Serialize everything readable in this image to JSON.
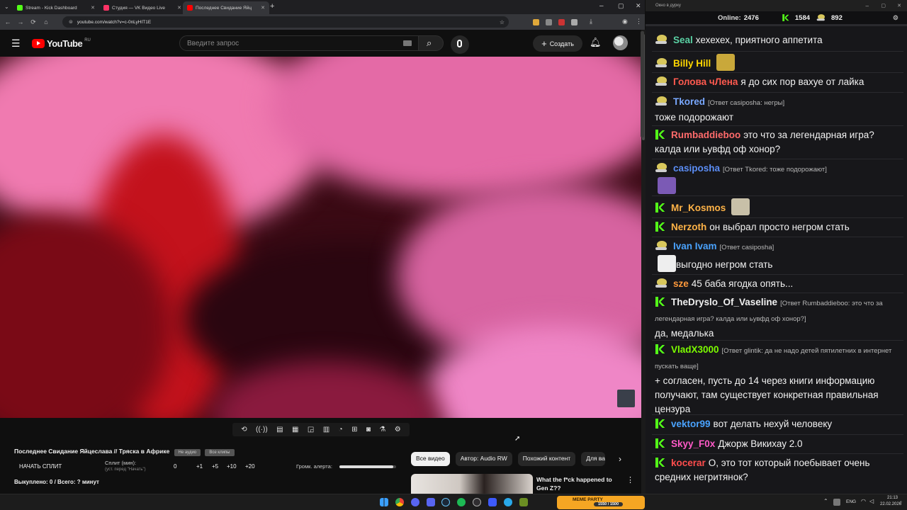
{
  "tabs": [
    {
      "title": "Stream - Kick Dashboard",
      "color": "#53fc18"
    },
    {
      "title": "Студия — VK Видео Live",
      "color": "#ff3366"
    },
    {
      "title": "Последнее Свидание Яйц",
      "color": "#ff0000"
    }
  ],
  "address": {
    "url": "youtube.com/watch?v=c-0nLyHIT1E"
  },
  "youtube": {
    "logo": "YouTube",
    "region": "RU",
    "search_placeholder": "Введите запрос",
    "create_label": "Создать"
  },
  "panel": {
    "video_title": "Последнее Свидание Яйцеслава // Тряска в Африке",
    "btn_to_audio": "Не аудио",
    "btn_all_clips": "Все клипы",
    "split_button": "НАЧАТЬ СПЛИТ",
    "split_label": "Сплит (мин):",
    "split_hint": "(уст. перед \"Начать\")",
    "split_values": [
      "0",
      "+1",
      "+5",
      "+10",
      "+20"
    ],
    "volume_label": "Громк. алерта:",
    "volume_level": 0.95,
    "status": "Выкуплено: 0 / Всего: ? минут"
  },
  "chips": [
    "Все видео",
    "Автор: Audio RW",
    "Похожий контент",
    "Для вас"
  ],
  "recommendation": {
    "title": "What the f*ck happened to Gen Z??"
  },
  "chat_window": {
    "title": "Окно в дурку"
  },
  "chat_header": {
    "online_label": "Online:",
    "online_count": "2476",
    "kick_count": "1584",
    "vk_count": "892"
  },
  "messages": [
    {
      "platform": "vk",
      "user": "Seal",
      "color": "#5ad1a4",
      "reply": "",
      "text": "хехехех, приятного аппетита"
    },
    {
      "platform": "vk",
      "user": "Billy Hill",
      "color": "#ffd700",
      "reply": "",
      "text": ""
    },
    {
      "platform": "vk",
      "user": "Голова чЛена",
      "color": "#ff5a4f",
      "reply": "",
      "text": "я до сих пор вахуе от лайка"
    },
    {
      "platform": "vk",
      "user": "Tkored",
      "color": "#79a8ff",
      "reply": "[Ответ casiposha: негры]",
      "text": "тоже подорожают"
    },
    {
      "platform": "kick",
      "user": "Rumbaddieboo",
      "color": "#ff6b6b",
      "reply": "",
      "text": "это что за легендарная игра? калда или ьувфд оф хонор?"
    },
    {
      "platform": "vk",
      "user": "casiposha",
      "color": "#5b8df5",
      "reply": "[Ответ Tkored: тоже подорожают]",
      "text": ""
    },
    {
      "platform": "kick",
      "user": "Mr_Kosmos",
      "color": "#ffb347",
      "reply": "",
      "text": ""
    },
    {
      "platform": "kick",
      "user": "Nerzoth",
      "color": "#ffb347",
      "reply": "",
      "text": "он выбрал просто негром стать"
    },
    {
      "platform": "vk",
      "user": "Ivan Ivam",
      "color": "#4aa3ff",
      "reply": "[Ответ casiposha]",
      "text": "выгодно негром стать"
    },
    {
      "platform": "vk",
      "user": "sze",
      "color": "#ff9a3c",
      "reply": "",
      "text": "45 баба ягодка опять..."
    },
    {
      "platform": "kick",
      "user": "TheDryslo_Of_Vaseline",
      "color": "#f0f0f0",
      "reply": "[Ответ Rumbaddieboo: это что за легендарная игра? калда или ьувфд оф хонор?]",
      "text": "да, медалька"
    },
    {
      "platform": "kick",
      "user": "VladX3000",
      "color": "#7cfc00",
      "reply": "[Ответ glintik: да не надо детей пятилетних в интернет пускать ваще]",
      "text": "+ согласен, пусть до 14 через книги информацию получают, там существует конкретная правильная цензура"
    },
    {
      "platform": "kick",
      "user": "vektor99",
      "color": "#4aa3ff",
      "reply": "",
      "text": "вот делать нехуй человеку"
    },
    {
      "platform": "kick",
      "user": "Skyy_F0x",
      "color": "#ff5ac8",
      "reply": "",
      "text": "Джорж Викихау 2.0"
    },
    {
      "platform": "kick",
      "user": "kocerar",
      "color": "#ff4d4d",
      "reply": "",
      "text": "О, это тот который поебывает очень средних негритянок?"
    }
  ],
  "taskbar": {
    "lang": "ENG",
    "time": "21:13",
    "date": "22.02.2026",
    "meme_party": "MEME PARTY",
    "meme_counter": "1550 / 1500"
  }
}
